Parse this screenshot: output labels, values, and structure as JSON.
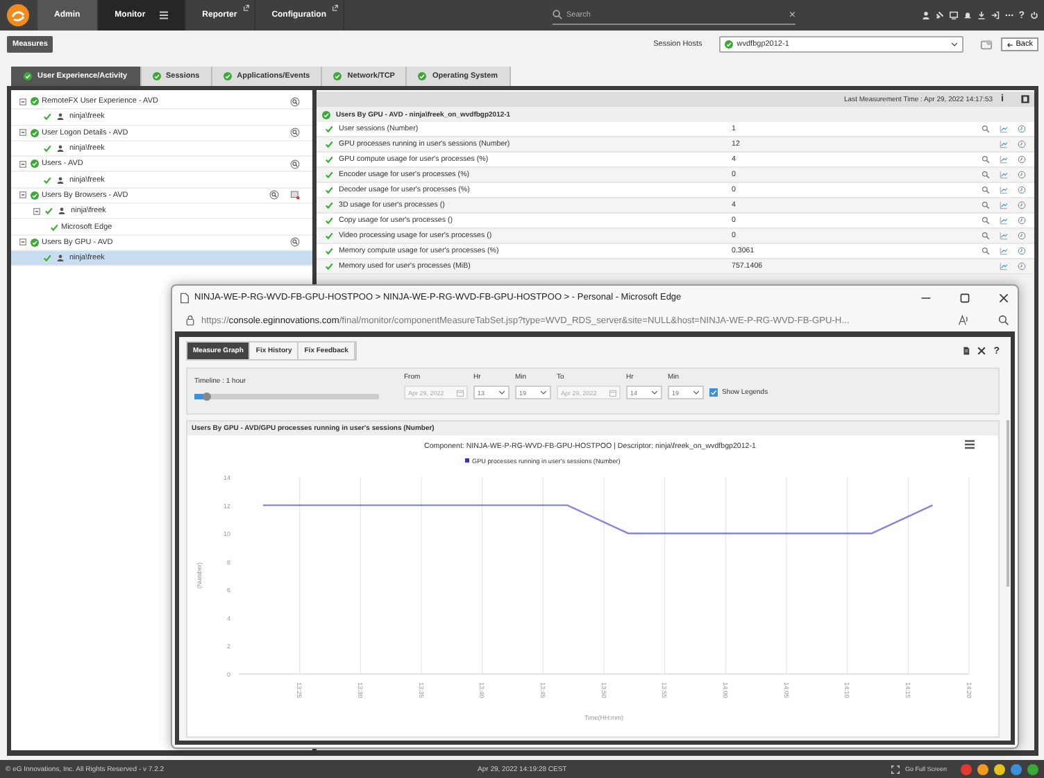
{
  "nav": {
    "tabs": [
      {
        "label": "Admin",
        "selected": false,
        "external": false,
        "menu": false
      },
      {
        "label": "Monitor",
        "selected": true,
        "external": false,
        "menu": true
      },
      {
        "label": "Reporter",
        "selected": false,
        "external": true,
        "menu": false
      },
      {
        "label": "Configuration",
        "selected": false,
        "external": true,
        "menu": false
      }
    ],
    "search": {
      "placeholder": "Search",
      "clear": "×"
    },
    "help": "?"
  },
  "toolbar": {
    "measures_button": "Measures",
    "session_hosts_label": "Session Hosts",
    "session_host": "wvdfbgp2012-1",
    "back_button": "Back"
  },
  "tabs": [
    {
      "label": "User Experience/Activity",
      "selected": true
    },
    {
      "label": "Sessions",
      "selected": false
    },
    {
      "label": "Applications/Events",
      "selected": false
    },
    {
      "label": "Network/TCP",
      "selected": false
    },
    {
      "label": "Operating System",
      "selected": false
    }
  ],
  "tree": [
    {
      "label": "RemoteFX User Experience - AVD",
      "expanded": true,
      "selected": false,
      "details_button": true,
      "alert_button": false,
      "children": [
        {
          "label": "ninja\\freek",
          "selected": false
        }
      ]
    },
    {
      "label": "User Logon Details - AVD",
      "expanded": true,
      "selected": false,
      "details_button": true,
      "alert_button": false,
      "children": [
        {
          "label": "ninja\\freek",
          "selected": false
        }
      ]
    },
    {
      "label": "Users - AVD",
      "expanded": true,
      "selected": false,
      "details_button": true,
      "alert_button": false,
      "children": [
        {
          "label": "ninja\\freek",
          "selected": false
        }
      ]
    },
    {
      "label": "Users By Browsers - AVD",
      "expanded": true,
      "selected": false,
      "details_button": true,
      "alert_button": true,
      "children": [
        {
          "label": "ninja\\freek",
          "selected": false,
          "expanded": true,
          "children": [
            {
              "label": "Microsoft Edge",
              "selected": false
            }
          ]
        }
      ]
    },
    {
      "label": "Users By GPU - AVD",
      "expanded": true,
      "selected": false,
      "details_button": true,
      "alert_button": false,
      "children": [
        {
          "label": "ninja\\freek",
          "selected": true
        }
      ]
    }
  ],
  "measures": {
    "last_measurement": "Last Measurement Time : Apr 29, 2022 14:17:53",
    "info": "i",
    "group": "Users By GPU - AVD - ninja\\freek_on_wvdfbgp2012-1",
    "rows": [
      {
        "name": "User sessions (Number)",
        "value": "1",
        "details": true
      },
      {
        "name": "GPU processes running in user's sessions (Number)",
        "value": "12",
        "details": false
      },
      {
        "name": "GPU compute usage for user's processes (%)",
        "value": "4",
        "details": true
      },
      {
        "name": "Encoder usage for user's processes (%)",
        "value": "0",
        "details": true
      },
      {
        "name": "Decoder usage for user's processes (%)",
        "value": "0",
        "details": true
      },
      {
        "name": "3D usage for user's processes ()",
        "value": "4",
        "details": true
      },
      {
        "name": "Copy usage for user's processes ()",
        "value": "0",
        "details": true
      },
      {
        "name": "Video processing usage for user's processes ()",
        "value": "0",
        "details": true
      },
      {
        "name": "Memory compute usage for user's processes (%)",
        "value": "0.3061",
        "details": true
      },
      {
        "name": "Memory used for user's processes (MiB)",
        "value": "757.1406",
        "details": false
      }
    ]
  },
  "browser": {
    "title": "NINJA-WE-P-RG-WVD-FB-GPU-HOSTPOO > NINJA-WE-P-RG-WVD-FB-GPU-HOSTPOO > - Personal - Microsoft Edge",
    "url_scheme": "https://",
    "url_host": "console.eginnovations.com",
    "url_path": "/final/monitor/componentMeasureTabSet.jsp?type=WVD_RDS_server&site=NULL&host=NINJA-WE-P-RG-WVD-FB-GPU-H...",
    "tabs": [
      {
        "label": "Measure Graph",
        "selected": true
      },
      {
        "label": "Fix History",
        "selected": false
      },
      {
        "label": "Fix Feedback",
        "selected": false
      }
    ],
    "help": "?",
    "timeline": {
      "label": "Timeline : 1 hour",
      "level": 0.07
    },
    "from": {
      "label": "From",
      "date": "Apr 29, 2022",
      "hour_label": "Hr",
      "hour": "13",
      "min_label": "Min",
      "min": "19"
    },
    "to": {
      "label": "To",
      "date": "Apr 29, 2022",
      "hour_label": "Hr",
      "hour": "14",
      "min_label": "Min",
      "min": "19"
    },
    "show_legends": {
      "label": "Show Legends",
      "checked": true
    },
    "graph_title": "Users By GPU - AVD/GPU processes running in user's sessions (Number)",
    "chart_data": {
      "type": "line",
      "title": "Component: NINJA-WE-P-RG-WVD-FB-GPU-HOSTPOO | Descriptor: ninja\\freek_on_wvdfbgp2012-1",
      "xlabel": "Time(HH:mm)",
      "ylabel": "(Number)",
      "x": [
        802,
        807,
        812,
        817,
        822,
        827,
        832,
        837,
        842,
        847,
        852,
        857
      ],
      "series": [
        {
          "name": "GPU processes running in user's sessions (Number)",
          "color": "#3333cc",
          "values": [
            12,
            12,
            12,
            12,
            12,
            12,
            10,
            10,
            10,
            10,
            10,
            12
          ]
        }
      ],
      "xlim": [
        800,
        860
      ],
      "ylim": [
        0,
        14
      ],
      "xticks": [
        {
          "value": 805,
          "label": "13:25"
        },
        {
          "value": 810,
          "label": "13:30"
        },
        {
          "value": 815,
          "label": "13:35"
        },
        {
          "value": 820,
          "label": "13:40"
        },
        {
          "value": 825,
          "label": "13:45"
        },
        {
          "value": 830,
          "label": "13:50"
        },
        {
          "value": 835,
          "label": "13:55"
        },
        {
          "value": 840,
          "label": "14:00"
        },
        {
          "value": 845,
          "label": "14:05"
        },
        {
          "value": 850,
          "label": "14:10"
        },
        {
          "value": 855,
          "label": "14:15"
        },
        {
          "value": 860,
          "label": "14:20"
        }
      ],
      "yticks": [
        0,
        2,
        4,
        6,
        8,
        10,
        12,
        14
      ],
      "grid": true
    }
  },
  "footer": {
    "copyright": "© eG Innovations, Inc. All Rights Reserved - v 7.2.2",
    "time": "Apr 29, 2022 14:19:28 CEST",
    "full_screen": "Go Full Screen",
    "alarms": [
      {
        "color": "#e23a2e"
      },
      {
        "color": "#f29a1f"
      },
      {
        "color": "#e8c21c"
      },
      {
        "color": "#3d8fd9"
      },
      {
        "color": "#3aa935"
      }
    ]
  }
}
